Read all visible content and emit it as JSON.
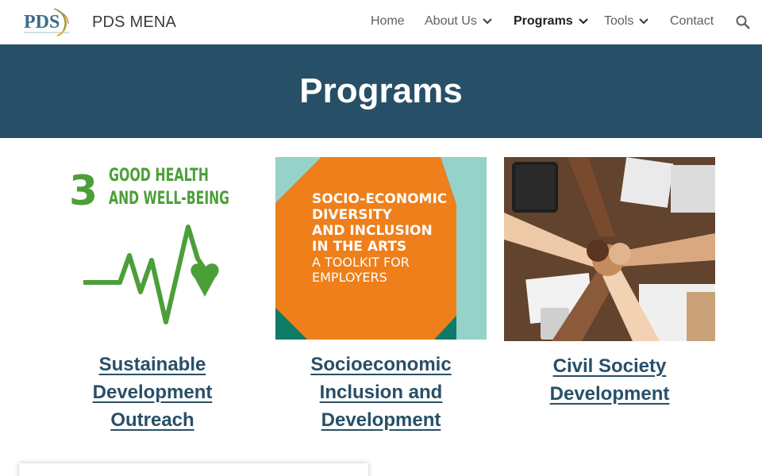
{
  "header": {
    "logo_text": "PDS",
    "site_title": "PDS MENA",
    "nav": [
      {
        "label": "Home"
      },
      {
        "label": "About Us"
      },
      {
        "label": "Programs"
      },
      {
        "label": "Tools"
      },
      {
        "label": "Contact"
      }
    ]
  },
  "banner": {
    "title": "Programs"
  },
  "cards": [
    {
      "image": {
        "sdg_number": "3",
        "sdg_line1": "GOOD HEALTH",
        "sdg_line2": "AND WELL-BEING"
      },
      "link_lines": [
        "Sustainable",
        "Development",
        "Outreach"
      ]
    },
    {
      "image": {
        "lines": [
          "SOCIO-ECONOMIC",
          "DIVERSITY",
          "AND INCLUSION",
          "IN THE ARTS"
        ],
        "sub_lines": [
          "A TOOLKIT FOR",
          "EMPLOYERS"
        ]
      },
      "link_lines": [
        "Socioeconomic",
        "Inclusion and",
        "Development"
      ]
    },
    {
      "image": {
        "desc_icon": "fist-bump-photo"
      },
      "link_lines": [
        "Civil Society",
        "Development"
      ]
    }
  ],
  "colors": {
    "banner": "#284f68",
    "link": "#284f68",
    "sdg_green": "#4c9f38",
    "toolkit_orange": "#ee7f1a",
    "toolkit_teal": "#0e7a67",
    "toolkit_mint": "#95d2c9"
  }
}
